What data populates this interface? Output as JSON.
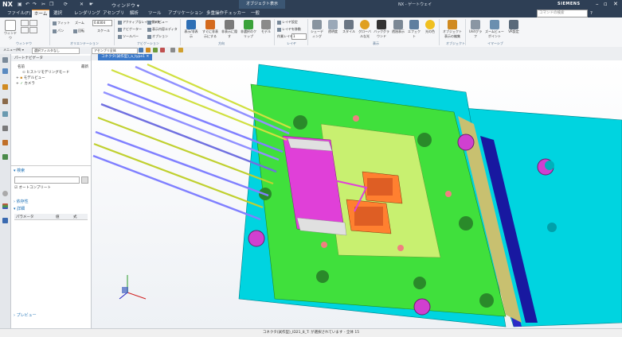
{
  "app": {
    "logo": "NX",
    "context_tab": "オブジェクト表示",
    "window_title": "NX - ゲートウェイ",
    "brand": "SIEMENS",
    "window_menu": "ウィンドウ ▾"
  },
  "tabs": [
    "ファイル(F)",
    "ホーム",
    "選択",
    "レンダリング",
    "アセンブリ",
    "解析",
    "ツール",
    "アプリケーション",
    "多重操作チェッカー",
    "一般"
  ],
  "active_tab": "ホーム",
  "search_placeholder": "コマンドの検索",
  "ribbon": {
    "window_btn": "ウィンドウ",
    "fit_btn": "フィット",
    "zoom_label": "ズーム",
    "zoom_value": "0.8304",
    "scale_label": "スケール",
    "pan_btn": "パン",
    "rotate_btn": "回転",
    "layout_items": [
      "アクティブなレイアウトを…",
      "ナビゲーター",
      "ツールバー"
    ],
    "option_items": [
      "前のビュー",
      "表示内容エディタ",
      "オプション"
    ],
    "display_btns": [
      "表示/非表示",
      "すぐに非表示にする",
      "非表示に隠す",
      "非選択のクリップ",
      "モデル"
    ],
    "layer_items": [
      "レイヤ設定",
      "レイヤを移動",
      "作業レイヤ"
    ],
    "layer_value": "1",
    "style_btns": [
      "シェーディング",
      "透明度",
      "スタイル",
      "グローバルな光",
      "バックグラウンド",
      "透過表示",
      "エフェクト",
      "光の色"
    ],
    "obj_btns": [
      "オブジェクト表示の編集",
      "Unitグラフ",
      "ズームビューポイント",
      "VR設定"
    ],
    "group_labels": [
      "ウィンドウ",
      "オリエンテーション",
      "ナビゲーション",
      "方向",
      "レイヤ",
      "表示",
      "オブジェクト",
      "イマーシブ"
    ]
  },
  "toolbar": {
    "menu_label": "メニュー(M) ▾",
    "filter_value": "選択フィルタなし",
    "assembly_value": "アセンブリ全体"
  },
  "navigator": {
    "title": "パートナビゲータ",
    "col_name": "名前",
    "col_update": "最新",
    "tree": [
      "ヒストリモデリングモード",
      "モデルビュー",
      "カメラ"
    ],
    "search_section": "検索",
    "autocomplete": "オートコンプリート",
    "dependency_section": "依存性",
    "details_section": "詳細",
    "detail_cols": [
      "パラメータ",
      "値",
      "式"
    ],
    "preview_section": "プレビュー"
  },
  "graphics": {
    "doc_tab": "コネクタ(試作型)_a_type1"
  },
  "status": {
    "text": "コネクタ(試作型)_ID21_8_T: が選択されています - 全体 15"
  },
  "colors": {
    "titlebar": "#2e3f55",
    "accent": "#f28c1e",
    "plate_cyan": "#00d4e0",
    "core_green": "#40e03c",
    "yellow_green": "#c8f070",
    "magenta": "#e040d8",
    "blue_block": "#3030c8"
  }
}
